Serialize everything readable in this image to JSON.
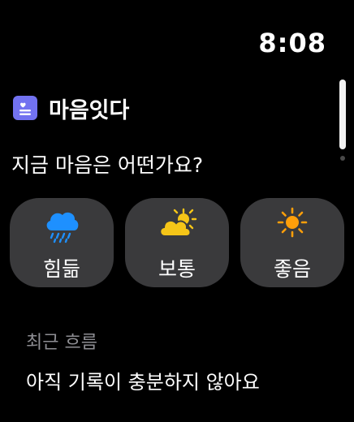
{
  "status": {
    "time": "8:08"
  },
  "app": {
    "title": "마음잇다",
    "icon": "note-heart-icon"
  },
  "prompt": {
    "question": "지금 마음은 어떤가요?"
  },
  "moods": [
    {
      "label": "힘듦",
      "icon": "rain-cloud-icon"
    },
    {
      "label": "보통",
      "icon": "sun-behind-cloud-icon"
    },
    {
      "label": "좋음",
      "icon": "sun-icon"
    }
  ],
  "recent": {
    "label": "최근 흐름",
    "value": "아직 기록이 충분하지 않아요"
  },
  "colors": {
    "background": "#000000",
    "button": "#3a3a3c",
    "accent": "#7272f0",
    "rain": "#1e90ff",
    "cloud": "#f5c518",
    "sun": "#ff9f0a",
    "secondary_text": "#8e8e93"
  }
}
